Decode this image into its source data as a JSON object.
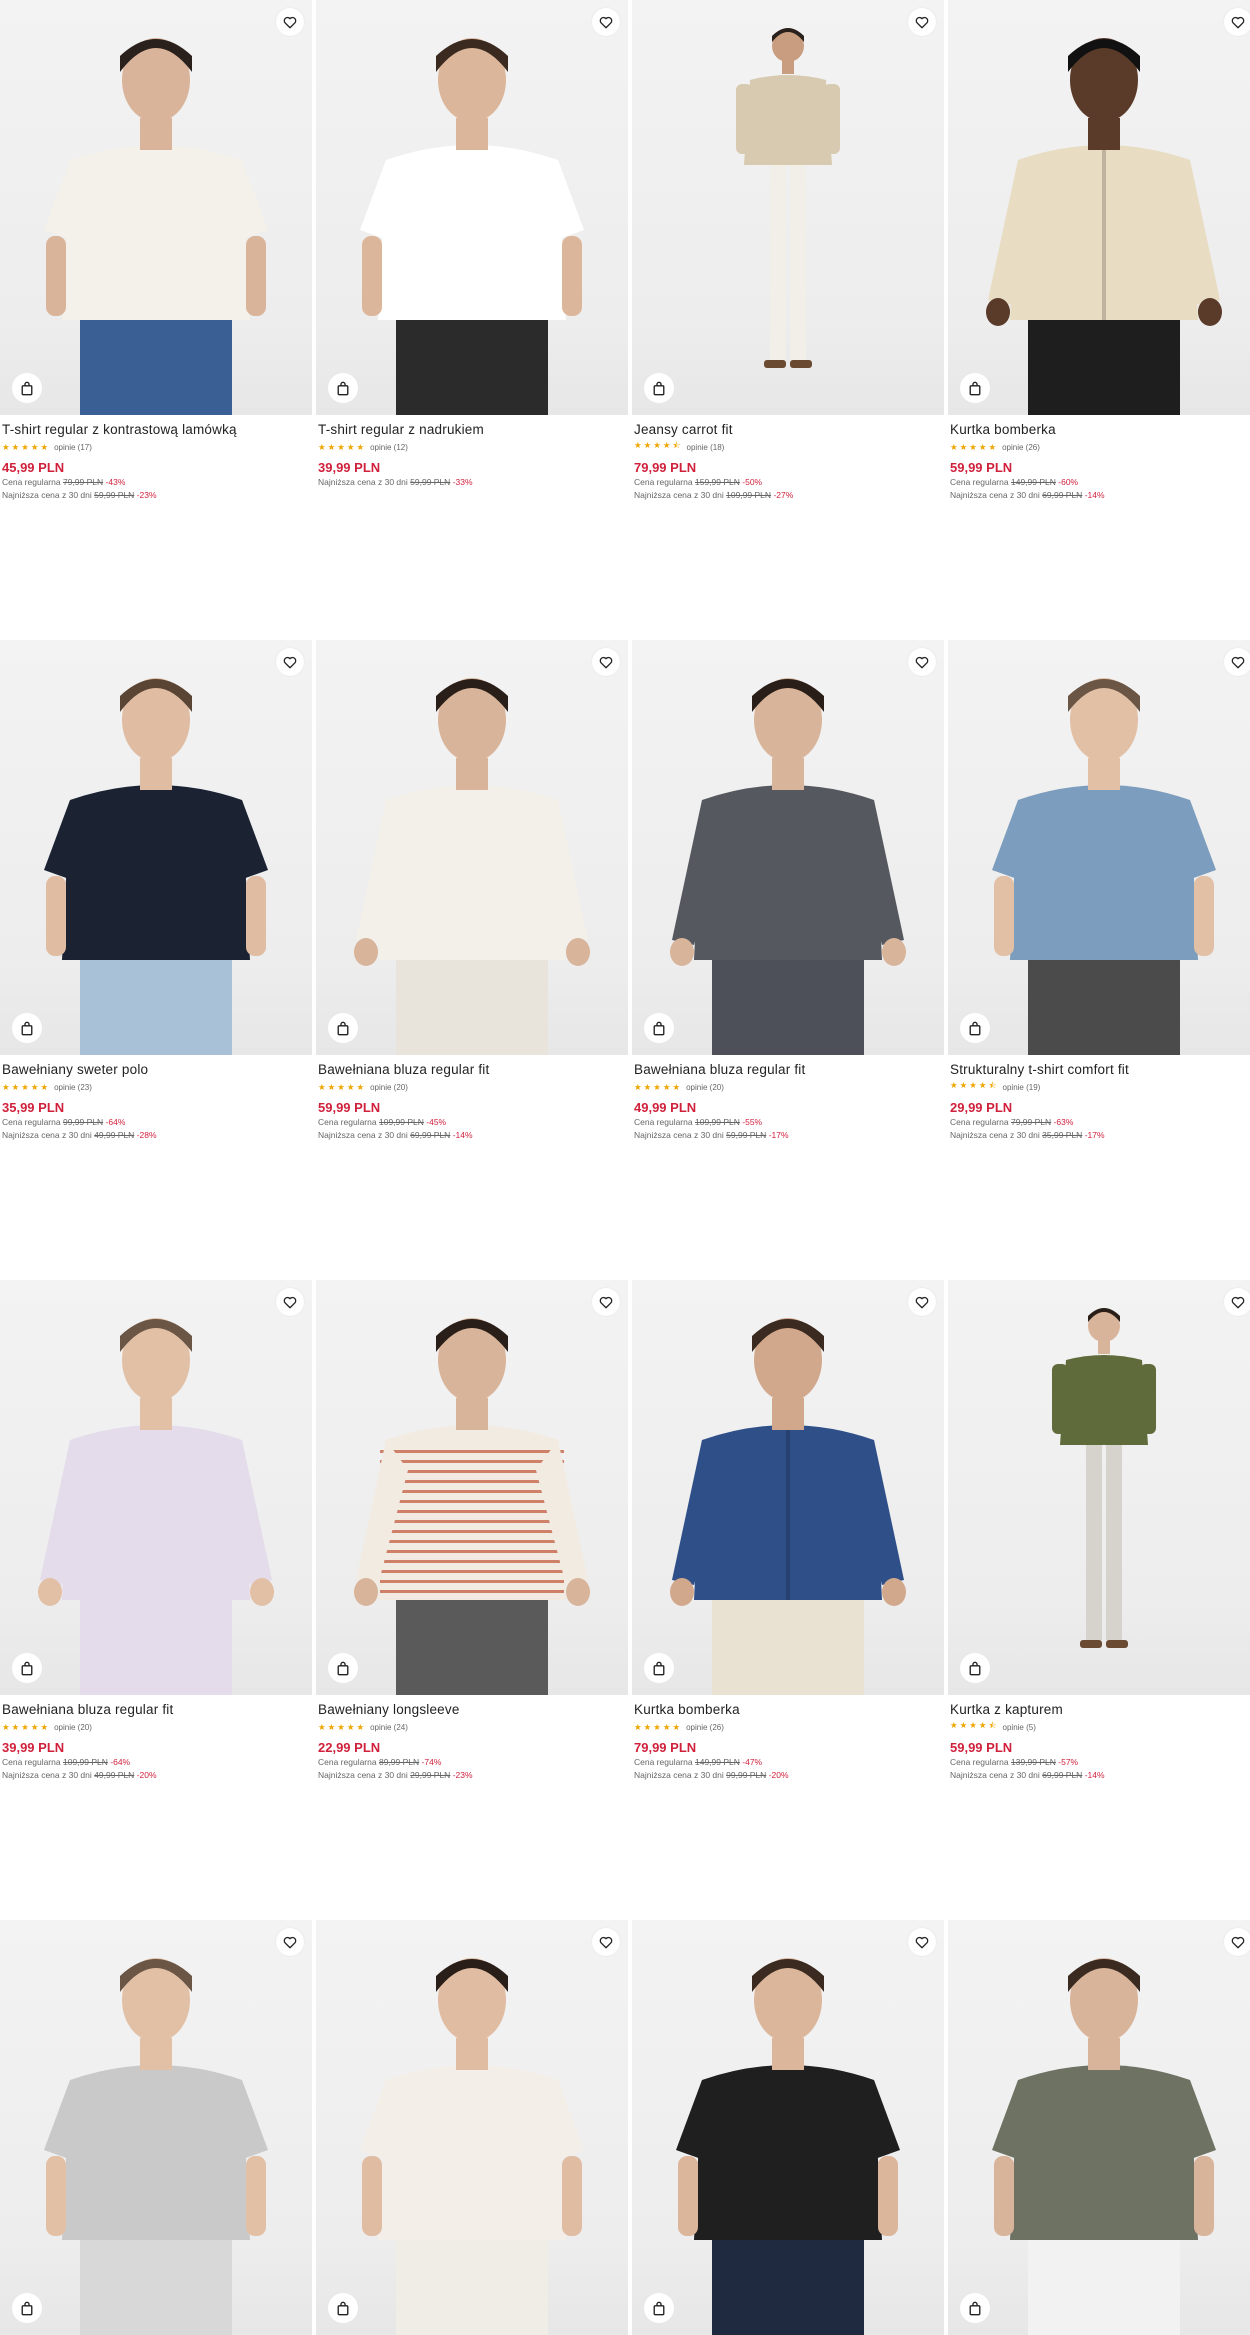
{
  "colors": {
    "accent": "#d0213c",
    "stars": "#f0a500",
    "text": "#222222",
    "muted": "#666666"
  },
  "labels": {
    "regular_prefix": "Cena regularna",
    "lowest_prefix": "Najniższa cena z 30 dni",
    "fav_icon": "heart-icon",
    "bag_icon": "shopping-bag-icon"
  },
  "products": [
    {
      "name": "T-shirt regular z kontrastową lamówką",
      "rating": 5,
      "reviews": "opinie (17)",
      "price": "45,99 PLN",
      "regular_price": "79,99 PLN",
      "regular_discount": "-43%",
      "lowest_price": "59,99 PLN",
      "lowest_discount": "-23%"
    },
    {
      "name": "T-shirt regular z nadrukiem",
      "rating": 5,
      "reviews": "opinie (12)",
      "price": "39,99 PLN",
      "lowest_price": "59,99 PLN",
      "lowest_discount": "-33%"
    },
    {
      "name": "Jeansy carrot fit",
      "rating": 4.5,
      "reviews": "opinie (18)",
      "price": "79,99 PLN",
      "regular_price": "159,99 PLN",
      "regular_discount": "-50%",
      "lowest_price": "109,99 PLN",
      "lowest_discount": "-27%"
    },
    {
      "name": "Kurtka bomberka",
      "rating": 5,
      "reviews": "opinie (26)",
      "price": "59,99 PLN",
      "regular_price": "149,99 PLN",
      "regular_discount": "-60%",
      "lowest_price": "69,99 PLN",
      "lowest_discount": "-14%"
    },
    {
      "name": "Bawełniany sweter polo",
      "rating": 5,
      "reviews": "opinie (23)",
      "price": "35,99 PLN",
      "regular_price": "99,99 PLN",
      "regular_discount": "-64%",
      "lowest_price": "49,99 PLN",
      "lowest_discount": "-28%"
    },
    {
      "name": "Bawełniana bluza regular fit",
      "rating": 5,
      "reviews": "opinie (20)",
      "price": "59,99 PLN",
      "regular_price": "109,99 PLN",
      "regular_discount": "-45%",
      "lowest_price": "69,99 PLN",
      "lowest_discount": "-14%"
    },
    {
      "name": "Bawełniana bluza regular fit",
      "rating": 5,
      "reviews": "opinie (20)",
      "price": "49,99 PLN",
      "regular_price": "109,99 PLN",
      "regular_discount": "-55%",
      "lowest_price": "59,99 PLN",
      "lowest_discount": "-17%"
    },
    {
      "name": "Strukturalny t-shirt comfort fit",
      "rating": 4.5,
      "reviews": "opinie (19)",
      "price": "29,99 PLN",
      "regular_price": "79,99 PLN",
      "regular_discount": "-63%",
      "lowest_price": "35,99 PLN",
      "lowest_discount": "-17%"
    },
    {
      "name": "Bawełniana bluza regular fit",
      "rating": 5,
      "reviews": "opinie (20)",
      "price": "39,99 PLN",
      "regular_price": "109,99 PLN",
      "regular_discount": "-64%",
      "lowest_price": "49,99 PLN",
      "lowest_discount": "-20%"
    },
    {
      "name": "Bawełniany longsleeve",
      "rating": 5,
      "reviews": "opinie (24)",
      "price": "22,99 PLN",
      "regular_price": "89,99 PLN",
      "regular_discount": "-74%",
      "lowest_price": "29,99 PLN",
      "lowest_discount": "-23%"
    },
    {
      "name": "Kurtka bomberka",
      "rating": 5,
      "reviews": "opinie (26)",
      "price": "79,99 PLN",
      "regular_price": "149,99 PLN",
      "regular_discount": "-47%",
      "lowest_price": "99,99 PLN",
      "lowest_discount": "-20%"
    },
    {
      "name": "Kurtka z kapturem",
      "rating": 4.5,
      "reviews": "opinie (5)",
      "price": "59,99 PLN",
      "regular_price": "139,99 PLN",
      "regular_discount": "-57%",
      "lowest_price": "69,99 PLN",
      "lowest_discount": "-14%"
    },
    {
      "name": "",
      "rating": null,
      "reviews": "",
      "price": ""
    },
    {
      "name": "",
      "rating": null,
      "reviews": "",
      "price": ""
    },
    {
      "name": "",
      "rating": null,
      "reviews": "",
      "price": ""
    },
    {
      "name": "",
      "rating": null,
      "reviews": "",
      "price": ""
    }
  ]
}
